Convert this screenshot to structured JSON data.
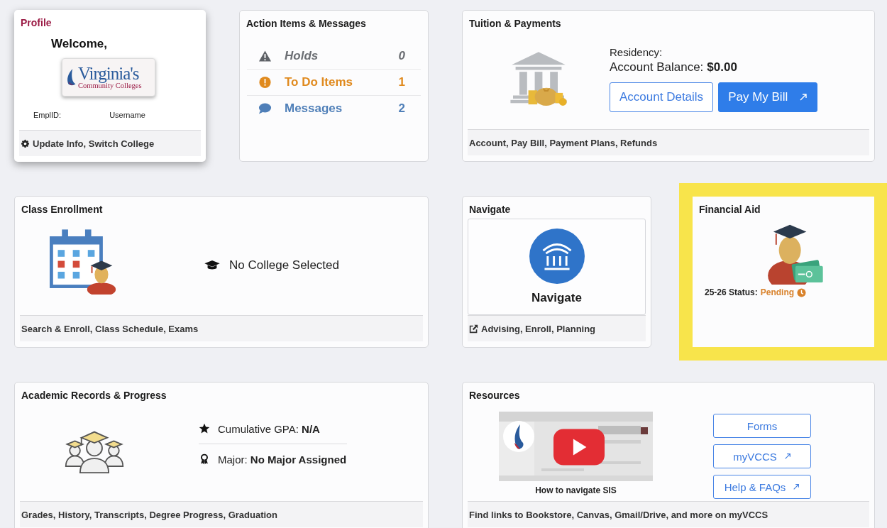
{
  "tiles": [
    {
      "kind": "profile",
      "title": "Profile",
      "welcome": "Welcome,",
      "logo": {
        "line1": "Virginia's",
        "line2": "Community Colleges"
      },
      "emplid_label": "EmplID:",
      "username_label": "Username",
      "footer": "Update Info, Switch College"
    },
    {
      "kind": "actions",
      "title": "Action Items & Messages",
      "items": [
        {
          "kind": "holds",
          "label": "Holds",
          "count": "0",
          "color": "#6b6e73"
        },
        {
          "kind": "todo",
          "label": "To Do Items",
          "count": "1",
          "color": "#e08a1e"
        },
        {
          "kind": "messages",
          "label": "Messages",
          "count": "2",
          "color": "#4f7fb8"
        }
      ]
    },
    {
      "kind": "tuition",
      "title": "Tuition & Payments",
      "residency_label": "Residency:",
      "balance_label": "Account Balance:",
      "balance": "$0.00",
      "buttons": [
        {
          "kind": "outline",
          "label": "Account Details",
          "external": false
        },
        {
          "kind": "primary",
          "label": "Pay My Bill",
          "external": true
        }
      ],
      "footer": "Account, Pay Bill, Payment Plans, Refunds"
    },
    {
      "kind": "enrollment",
      "title": "Class Enrollment",
      "status": "No College Selected",
      "footer": "Search & Enroll, Class Schedule, Exams"
    },
    {
      "kind": "navigate",
      "title": "Navigate",
      "label": "Navigate",
      "footer": "Advising, Enroll, Planning"
    },
    {
      "kind": "financial_aid",
      "title": "Financial Aid",
      "highlighted": true,
      "status_label": "25-26 Status:",
      "status": "Pending"
    },
    {
      "kind": "academic",
      "title": "Academic Records & Progress",
      "rows": [
        {
          "kind": "gpa",
          "label": "Cumulative GPA:",
          "value": "N/A"
        },
        {
          "kind": "major",
          "label": "Major:",
          "value": "No Major Assigned"
        }
      ],
      "footer": "Grades, History, Transcripts, Degree Progress, Graduation"
    },
    {
      "kind": "resources",
      "title": "Resources",
      "video": {
        "caption": "How to navigate SIS"
      },
      "buttons": [
        {
          "label": "Forms",
          "external": false
        },
        {
          "label": "myVCCS",
          "external": true
        },
        {
          "label": "Help & FAQs",
          "external": true
        }
      ],
      "footer": "Find links to Bookstore, Canvas, Gmail/Drive, and more on myVCCS"
    }
  ]
}
